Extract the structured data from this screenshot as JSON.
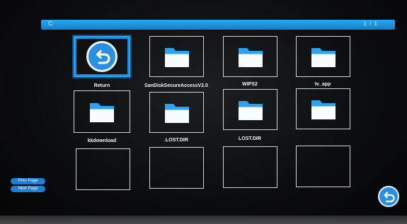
{
  "header": {
    "path": "C:",
    "page_indicator": "1 / 1"
  },
  "tiles": [
    {
      "label": "Return",
      "type": "return",
      "selected": true
    },
    {
      "label": "SanDiskSecureAccessV2.0",
      "type": "folder"
    },
    {
      "label": "WIPS2",
      "type": "folder"
    },
    {
      "label": "tv_app",
      "type": "folder"
    },
    {
      "label": "kkdownload",
      "type": "folder"
    },
    {
      "label": ".LOST.DIR",
      "type": "folder"
    },
    {
      "label": "LOST.DIR",
      "type": "folder"
    },
    {
      "label": "",
      "type": "folder"
    },
    {
      "label": "",
      "type": "empty"
    },
    {
      "label": "",
      "type": "empty"
    },
    {
      "label": "",
      "type": "empty"
    },
    {
      "label": "",
      "type": "empty"
    }
  ],
  "side_buttons": {
    "prev": "Prev Page",
    "next": "Next Page"
  },
  "colors": {
    "accent": "#1e8fe6",
    "folder": "#29a3f0",
    "tile_border": "#cfd3d6"
  },
  "icons": {
    "folder": "folder-icon",
    "return": "return-arrow-icon",
    "back": "back-icon"
  }
}
